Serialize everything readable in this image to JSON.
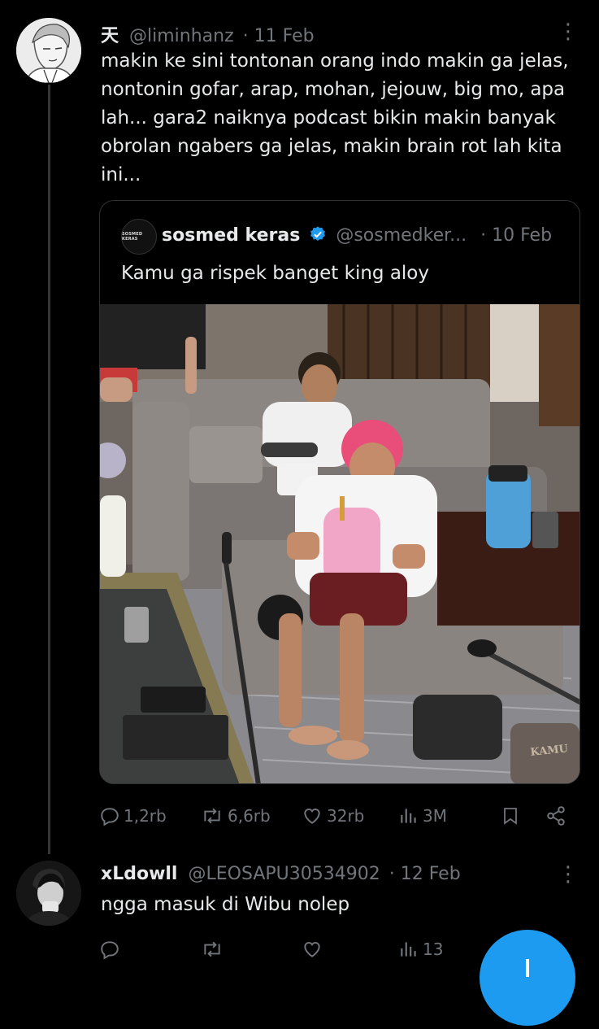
{
  "tweet": {
    "author_name": "天",
    "handle": "@liminhanz",
    "date": "· 11 Feb",
    "text": "makin ke sini tontonan orang indo makin ga jelas, nontonin gofar, arap, mohan, jejouw, big mo, apa lah... gara2 naiknya podcast bikin makin banyak obrolan ngabers ga jelas, makin brain rot lah kita ini...",
    "more": "⋮",
    "stats": {
      "replies": "1,2rb",
      "reposts": "6,6rb",
      "likes": "32rb",
      "views": "3M"
    }
  },
  "quoted": {
    "author_name": "sosmed keras",
    "handle": "@sosmedker...",
    "date": "· 10 Feb",
    "text": "Kamu ga rispek banget king aloy",
    "avatar_text": "SOSMED KERAS",
    "watermark": "KAMU"
  },
  "reply": {
    "author_name": "xLdowll",
    "handle": "@LEOSAPU30534902",
    "date": "· 12 Feb",
    "text": "ngga masuk di Wibu nolep",
    "more": "⋮",
    "stats": {
      "views": "13"
    }
  },
  "colors": {
    "background": "#000000",
    "text": "#e7e9ea",
    "muted": "#71767b",
    "verified": "#1d9bf0",
    "fab": "#1d9bf0"
  }
}
